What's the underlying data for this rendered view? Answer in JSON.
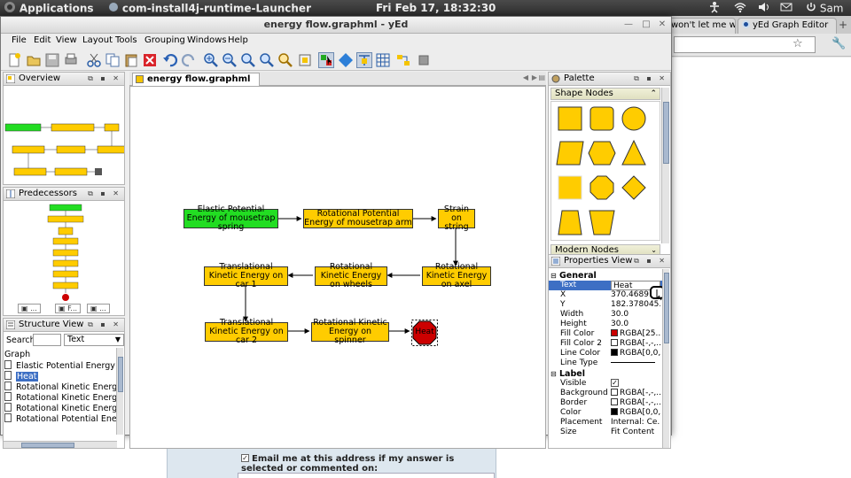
{
  "top_panel": {
    "applications": "Applications",
    "active_task": "com-install4j-runtime-Launcher",
    "clock": "Fri Feb 17, 18:32:30",
    "user": "Sam"
  },
  "browser": {
    "tabs": [
      "won't let me w",
      "yEd Graph Editor"
    ],
    "email_label": "Email me at this address if my answer is selected or commented on:"
  },
  "yed": {
    "title": "energy flow.graphml - yEd",
    "menus": [
      "File",
      "Edit",
      "View",
      "Layout",
      "Tools",
      "Grouping",
      "Windows",
      "Help"
    ],
    "tab_label": "energy flow.graphml",
    "overview_title": "Overview",
    "predecessors_title": "Predecessors",
    "structure_title": "Structure View",
    "structure_search_label": "Search",
    "structure_search_value": "",
    "structure_filter": "Text",
    "structure_items": [
      "Graph",
      "Elastic Potential Energy of m",
      "Heat",
      "Rotational Kinetic Energy on",
      "Rotational Kinetic Energy on",
      "Rotational Kinetic Energy on",
      "Rotational Potential Energy o"
    ],
    "palette_title": "Palette",
    "palette_sections": [
      "Shape Nodes",
      "Modern Nodes"
    ],
    "properties_title": "Properties View",
    "properties": {
      "group_general": "General",
      "group_label": "Label",
      "rows": [
        {
          "key": "Text",
          "value": "Heat"
        },
        {
          "key": "X",
          "value": "370.4689150"
        },
        {
          "key": "Y",
          "value": "182.378045..."
        },
        {
          "key": "Width",
          "value": "30.0"
        },
        {
          "key": "Height",
          "value": "30.0"
        },
        {
          "key": "Fill Color",
          "value": "RGBA[25..."
        },
        {
          "key": "Fill Color 2",
          "value": "RGBA[-,-,..."
        },
        {
          "key": "Line Color",
          "value": "RGBA[0,0,..."
        },
        {
          "key": "Line Type",
          "value": ""
        }
      ],
      "label_rows": [
        {
          "key": "Visible",
          "value": ""
        },
        {
          "key": "Background",
          "value": "RGBA[-,-,..."
        },
        {
          "key": "Border",
          "value": "RGBA[-,-,..."
        },
        {
          "key": "Color",
          "value": "RGBA[0,0,..."
        },
        {
          "key": "Placement",
          "value": "Internal: Ce..."
        },
        {
          "key": "Size",
          "value": "Fit Content"
        }
      ]
    },
    "nodes": {
      "n1": "Elastic Potential Energy of mousetrap spring",
      "n2": "Rotational Potential Energy of mousetrap arm",
      "n3": "Strain on string",
      "n4": "Rotational Kinetic Energy on axel",
      "n5": "Rotational Kinetic Energy on wheels",
      "n6": "Translational Kinetic Energy on car 1",
      "n7": "Translational Kinetic Energy on car 2",
      "n8": "Rotational Kinetic Energy on spinner",
      "n9": "Heat"
    }
  },
  "colors": {
    "node_fill": "#ffcc00",
    "start_node_fill": "#22dd22",
    "heat_fill": "#cc0000",
    "selection": "#3d6fc4"
  }
}
